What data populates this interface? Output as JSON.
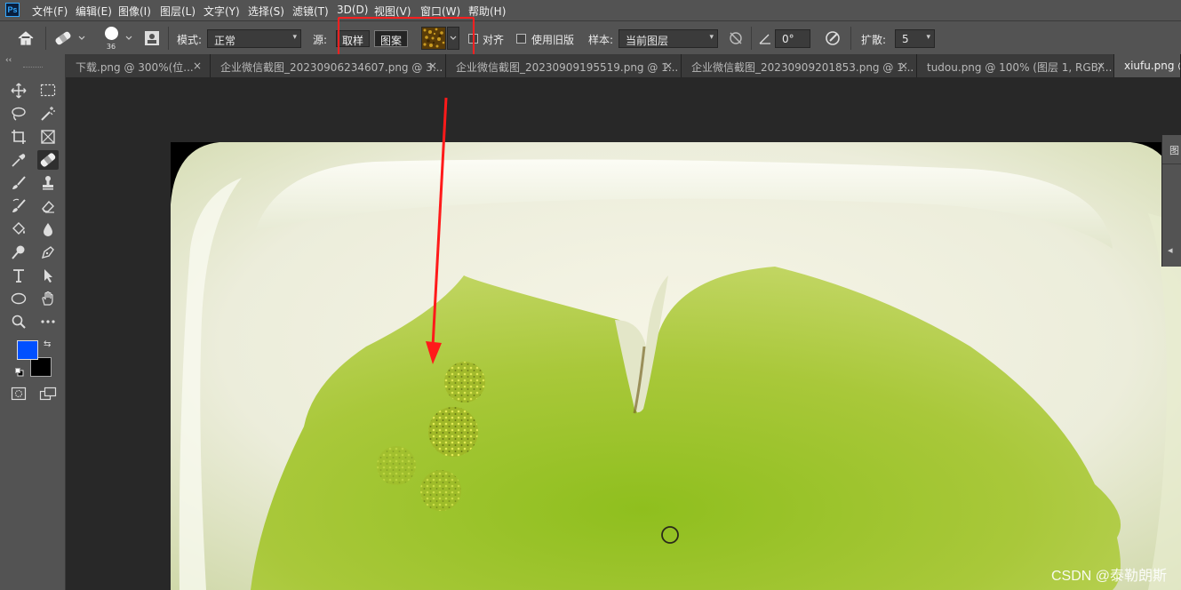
{
  "app": {
    "logo_text": "Ps"
  },
  "menu": {
    "items": [
      "文件(F)",
      "编辑(E)",
      "图像(I)",
      "图层(L)",
      "文字(Y)",
      "选择(S)",
      "滤镜(T)",
      "3D(D)",
      "视图(V)",
      "窗口(W)",
      "帮助(H)"
    ]
  },
  "options": {
    "brush_size": "36",
    "mode_label": "模式:",
    "mode_value": "正常",
    "source_label": "源:",
    "source_sampled": "取样",
    "source_pattern": "图案",
    "aligned_label": "对齐",
    "legacy_label": "使用旧版",
    "sample_label": "样本:",
    "sample_value": "当前图层",
    "angle_value": "0°",
    "diffusion_label": "扩散:",
    "diffusion_value": "5"
  },
  "colors": {
    "foreground": "#0050ff",
    "background": "#000000",
    "highlight": "#ff2020"
  },
  "tabs": [
    {
      "label": "下载.png @ 300%(位...",
      "active": false
    },
    {
      "label": "企业微信截图_20230906234607.png @ 3...",
      "active": false
    },
    {
      "label": "企业微信截图_20230909195519.png @ 1...",
      "active": false
    },
    {
      "label": "企业微信截图_20230909201853.png @ 1...",
      "active": false
    },
    {
      "label": "tudou.png @ 100% (图层 1, RGB/...",
      "active": false
    },
    {
      "label": "xiufu.png @",
      "active": true
    }
  ],
  "tab_close_glyph": "×",
  "panel": {
    "title": "图",
    "arrow": "◂"
  },
  "watermark": "CSDN @泰勒朗斯"
}
